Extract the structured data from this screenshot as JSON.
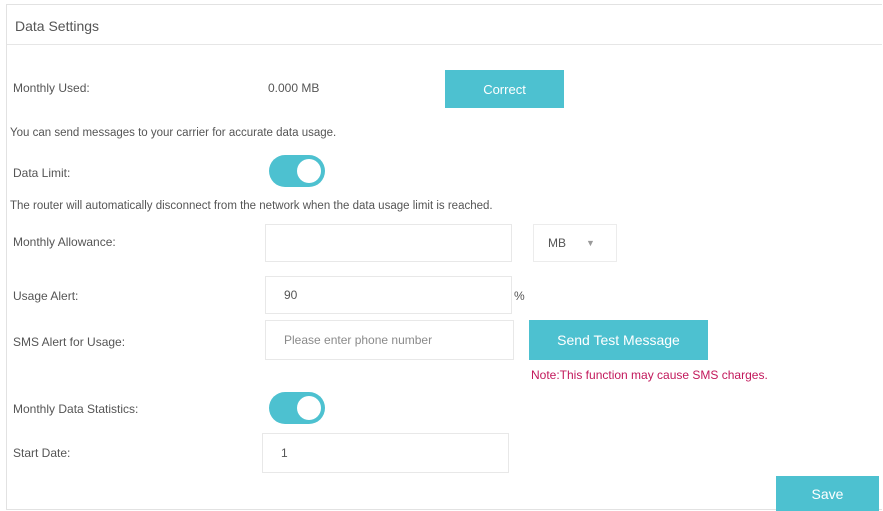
{
  "header": {
    "title": "Data Settings"
  },
  "monthly_used": {
    "label": "Monthly Used:",
    "value": "0.000 MB",
    "correct_button": "Correct"
  },
  "carrier_note": "You can send messages to your carrier for accurate data usage.",
  "data_limit": {
    "label": "Data Limit:",
    "enabled": true
  },
  "router_note": "The router will automatically disconnect from the network when the data usage limit is reached.",
  "monthly_allowance": {
    "label": "Monthly Allowance:",
    "value": "",
    "unit_selected": "MB"
  },
  "usage_alert": {
    "label": "Usage Alert:",
    "value": "90",
    "unit": "%"
  },
  "sms_alert": {
    "label": "SMS Alert for Usage:",
    "placeholder": "Please enter phone number",
    "send_button": "Send Test Message",
    "warning": "Note:This function may cause SMS charges."
  },
  "monthly_stats": {
    "label": "Monthly Data Statistics:",
    "enabled": true
  },
  "start_date": {
    "label": "Start Date:",
    "value": "1"
  },
  "footer": {
    "save_button": "Save"
  },
  "colors": {
    "accent": "#4dc1d0",
    "warning": "#c2185b"
  }
}
